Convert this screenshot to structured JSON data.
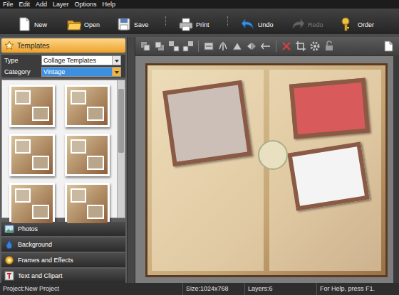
{
  "menu": [
    {
      "label": "File"
    },
    {
      "label": "Edit"
    },
    {
      "label": "Add"
    },
    {
      "label": "Layer"
    },
    {
      "label": "Options"
    },
    {
      "label": "Help"
    }
  ],
  "toolbar": [
    {
      "label": "New",
      "disabled": false
    },
    {
      "label": "Open",
      "disabled": false
    },
    {
      "label": "Save",
      "disabled": false
    },
    {
      "label": "Print",
      "disabled": false
    },
    {
      "label": "Undo",
      "disabled": false
    },
    {
      "label": "Redo",
      "disabled": true
    },
    {
      "label": "Order",
      "disabled": false
    }
  ],
  "templates_panel": {
    "title": "Templates",
    "expanded": true,
    "fields": [
      {
        "label": "Type",
        "value": "Collage Templates",
        "highlighted": false
      },
      {
        "label": "Category",
        "value": "Vintage",
        "highlighted": true
      }
    ],
    "thumbnails": [
      {
        "selected": false
      },
      {
        "selected": false
      },
      {
        "selected": false
      },
      {
        "selected": false
      },
      {
        "selected": false
      },
      {
        "selected": false
      }
    ]
  },
  "sections": [
    {
      "label": "Photos",
      "expanded": false
    },
    {
      "label": "Background",
      "expanded": false
    },
    {
      "label": "Frames and Effects",
      "expanded": false
    },
    {
      "label": "Text and Clipart",
      "expanded": false
    }
  ],
  "status_bar": [
    {
      "text": "Project:New Project"
    },
    {
      "text": "Size:1024x768"
    },
    {
      "text": "Layers:6"
    },
    {
      "text": "For Help, press F1."
    }
  ]
}
